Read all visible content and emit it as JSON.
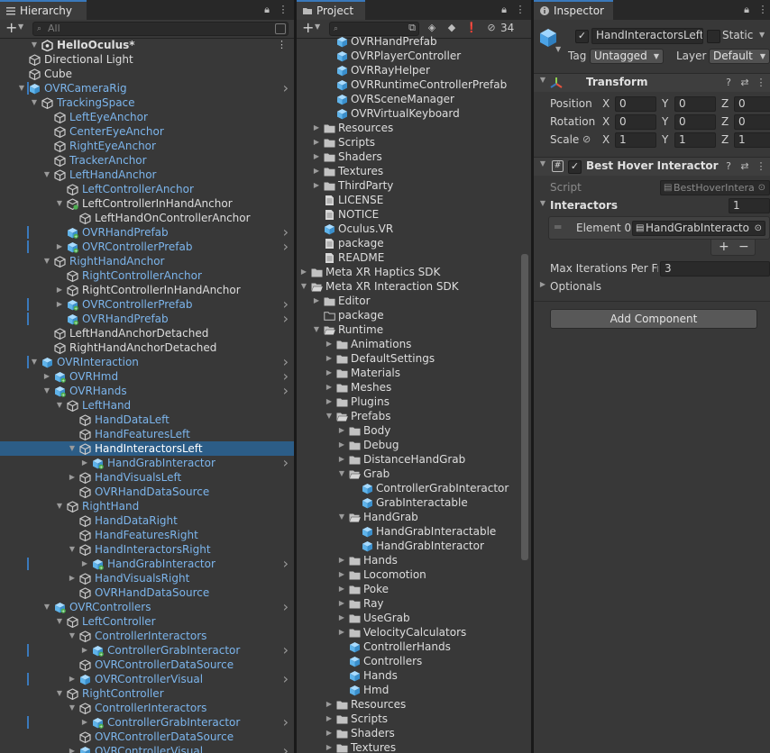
{
  "hierarchy": {
    "tab_label": "Hierarchy",
    "add_label": "+",
    "search_placeholder": "All",
    "scene_name": "HelloOculus*",
    "rows": [
      {
        "label": "Directional Light",
        "depth": 1,
        "color": "white",
        "arrow": "",
        "icon": "cube-outline"
      },
      {
        "label": "Cube",
        "depth": 1,
        "color": "white",
        "arrow": "",
        "icon": "cube-outline"
      },
      {
        "label": "OVRCameraRig",
        "depth": 1,
        "color": "blue",
        "arrow": "open",
        "icon": "prefab",
        "chev": true,
        "bar": true
      },
      {
        "label": "TrackingSpace",
        "depth": 2,
        "color": "blue",
        "arrow": "open",
        "icon": "cube-outline"
      },
      {
        "label": "LeftEyeAnchor",
        "depth": 3,
        "color": "blue",
        "arrow": "",
        "icon": "cube-outline"
      },
      {
        "label": "CenterEyeAnchor",
        "depth": 3,
        "color": "blue",
        "arrow": "",
        "icon": "cube-outline"
      },
      {
        "label": "RightEyeAnchor",
        "depth": 3,
        "color": "blue",
        "arrow": "",
        "icon": "cube-outline"
      },
      {
        "label": "TrackerAnchor",
        "depth": 3,
        "color": "blue",
        "arrow": "",
        "icon": "cube-outline"
      },
      {
        "label": "LeftHandAnchor",
        "depth": 3,
        "color": "blue",
        "arrow": "open",
        "icon": "cube-outline"
      },
      {
        "label": "LeftControllerAnchor",
        "depth": 4,
        "color": "blue",
        "arrow": "",
        "icon": "cube-outline"
      },
      {
        "label": "LeftControllerInHandAnchor",
        "depth": 4,
        "color": "white",
        "arrow": "open",
        "icon": "cube-green"
      },
      {
        "label": "LeftHandOnControllerAnchor",
        "depth": 5,
        "color": "white",
        "arrow": "",
        "icon": "cube-outline"
      },
      {
        "label": "OVRHandPrefab",
        "depth": 4,
        "color": "blue",
        "arrow": "",
        "icon": "prefab-green",
        "chev": true,
        "bar": true
      },
      {
        "label": "OVRControllerPrefab",
        "depth": 4,
        "color": "blue",
        "arrow": "closed",
        "icon": "prefab-green",
        "chev": true,
        "bar": true
      },
      {
        "label": "RightHandAnchor",
        "depth": 3,
        "color": "blue",
        "arrow": "open",
        "icon": "cube-outline"
      },
      {
        "label": "RightControllerAnchor",
        "depth": 4,
        "color": "blue",
        "arrow": "",
        "icon": "cube-outline"
      },
      {
        "label": "RightControllerInHandAnchor",
        "depth": 4,
        "color": "white",
        "arrow": "closed",
        "icon": "cube-outline"
      },
      {
        "label": "OVRControllerPrefab",
        "depth": 4,
        "color": "blue",
        "arrow": "closed",
        "icon": "prefab-green",
        "chev": true,
        "bar": true
      },
      {
        "label": "OVRHandPrefab",
        "depth": 4,
        "color": "blue",
        "arrow": "",
        "icon": "prefab-green",
        "chev": true,
        "bar": true
      },
      {
        "label": "LeftHandAnchorDetached",
        "depth": 3,
        "color": "white",
        "arrow": "",
        "icon": "cube-outline"
      },
      {
        "label": "RightHandAnchorDetached",
        "depth": 3,
        "color": "white",
        "arrow": "",
        "icon": "cube-outline"
      },
      {
        "label": "OVRInteraction",
        "depth": 2,
        "color": "blue",
        "arrow": "open",
        "icon": "prefab",
        "chev": true,
        "bar": true
      },
      {
        "label": "OVRHmd",
        "depth": 3,
        "color": "blue",
        "arrow": "closed",
        "icon": "prefab-green",
        "chev": true
      },
      {
        "label": "OVRHands",
        "depth": 3,
        "color": "blue",
        "arrow": "open",
        "icon": "prefab-green",
        "chev": true
      },
      {
        "label": "LeftHand",
        "depth": 4,
        "color": "blue",
        "arrow": "open",
        "icon": "cube-outline"
      },
      {
        "label": "HandDataLeft",
        "depth": 5,
        "color": "blue",
        "arrow": "",
        "icon": "cube-outline"
      },
      {
        "label": "HandFeaturesLeft",
        "depth": 5,
        "color": "blue",
        "arrow": "",
        "icon": "cube-outline"
      },
      {
        "label": "HandInteractorsLeft",
        "depth": 5,
        "color": "white",
        "arrow": "open",
        "icon": "cube-outline",
        "selected": true
      },
      {
        "label": "HandGrabInteractor",
        "depth": 6,
        "color": "blue",
        "arrow": "closed",
        "icon": "prefab-green",
        "chev": true
      },
      {
        "label": "HandVisualsLeft",
        "depth": 5,
        "color": "blue",
        "arrow": "closed",
        "icon": "cube-outline"
      },
      {
        "label": "OVRHandDataSource",
        "depth": 5,
        "color": "blue",
        "arrow": "",
        "icon": "cube-outline"
      },
      {
        "label": "RightHand",
        "depth": 4,
        "color": "blue",
        "arrow": "open",
        "icon": "cube-outline"
      },
      {
        "label": "HandDataRight",
        "depth": 5,
        "color": "blue",
        "arrow": "",
        "icon": "cube-outline"
      },
      {
        "label": "HandFeaturesRight",
        "depth": 5,
        "color": "blue",
        "arrow": "",
        "icon": "cube-outline"
      },
      {
        "label": "HandInteractorsRight",
        "depth": 5,
        "color": "blue",
        "arrow": "open",
        "icon": "cube-outline"
      },
      {
        "label": "HandGrabInteractor",
        "depth": 6,
        "color": "blue",
        "arrow": "closed",
        "icon": "prefab-green",
        "chev": true,
        "bar": true
      },
      {
        "label": "HandVisualsRight",
        "depth": 5,
        "color": "blue",
        "arrow": "closed",
        "icon": "cube-outline"
      },
      {
        "label": "OVRHandDataSource",
        "depth": 5,
        "color": "blue",
        "arrow": "",
        "icon": "cube-outline"
      },
      {
        "label": "OVRControllers",
        "depth": 3,
        "color": "blue",
        "arrow": "open",
        "icon": "prefab-green",
        "chev": true
      },
      {
        "label": "LeftController",
        "depth": 4,
        "color": "blue",
        "arrow": "open",
        "icon": "cube-outline"
      },
      {
        "label": "ControllerInteractors",
        "depth": 5,
        "color": "blue",
        "arrow": "open",
        "icon": "cube-outline"
      },
      {
        "label": "ControllerGrabInteractor",
        "depth": 6,
        "color": "blue",
        "arrow": "closed",
        "icon": "prefab-green",
        "chev": true,
        "bar": true
      },
      {
        "label": "OVRControllerDataSource",
        "depth": 5,
        "color": "blue",
        "arrow": "",
        "icon": "cube-outline"
      },
      {
        "label": "OVRControllerVisual",
        "depth": 5,
        "color": "blue",
        "arrow": "closed",
        "icon": "prefab",
        "chev": true,
        "bar": true
      },
      {
        "label": "RightController",
        "depth": 4,
        "color": "blue",
        "arrow": "open",
        "icon": "cube-outline"
      },
      {
        "label": "ControllerInteractors",
        "depth": 5,
        "color": "blue",
        "arrow": "open",
        "icon": "cube-outline"
      },
      {
        "label": "ControllerGrabInteractor",
        "depth": 6,
        "color": "blue",
        "arrow": "closed",
        "icon": "prefab-green",
        "chev": true,
        "bar": true
      },
      {
        "label": "OVRControllerDataSource",
        "depth": 5,
        "color": "blue",
        "arrow": "",
        "icon": "cube-outline"
      },
      {
        "label": "OVRControllerVisual",
        "depth": 5,
        "color": "blue",
        "arrow": "closed",
        "icon": "prefab",
        "chev": true
      }
    ]
  },
  "project": {
    "tab_label": "Project",
    "add_label": "+",
    "hidden_count": "34",
    "rows": [
      {
        "label": "OVRHandPrefab",
        "depth": 4,
        "arrow": "",
        "icon": "prefab"
      },
      {
        "label": "OVRPlayerController",
        "depth": 4,
        "arrow": "",
        "icon": "prefab"
      },
      {
        "label": "OVRRayHelper",
        "depth": 4,
        "arrow": "",
        "icon": "prefab"
      },
      {
        "label": "OVRRuntimeControllerPrefab",
        "depth": 4,
        "arrow": "",
        "icon": "prefab"
      },
      {
        "label": "OVRSceneManager",
        "depth": 4,
        "arrow": "",
        "icon": "prefab"
      },
      {
        "label": "OVRVirtualKeyboard",
        "depth": 4,
        "arrow": "",
        "icon": "prefab"
      },
      {
        "label": "Resources",
        "depth": 3,
        "arrow": "closed",
        "icon": "folder"
      },
      {
        "label": "Scripts",
        "depth": 3,
        "arrow": "closed",
        "icon": "folder"
      },
      {
        "label": "Shaders",
        "depth": 3,
        "arrow": "closed",
        "icon": "folder"
      },
      {
        "label": "Textures",
        "depth": 3,
        "arrow": "closed",
        "icon": "folder"
      },
      {
        "label": "ThirdParty",
        "depth": 3,
        "arrow": "closed",
        "icon": "folder"
      },
      {
        "label": "LICENSE",
        "depth": 3,
        "arrow": "",
        "icon": "doc"
      },
      {
        "label": "NOTICE",
        "depth": 3,
        "arrow": "",
        "icon": "doc"
      },
      {
        "label": "Oculus.VR",
        "depth": 3,
        "arrow": "",
        "icon": "asm"
      },
      {
        "label": "package",
        "depth": 3,
        "arrow": "",
        "icon": "doc"
      },
      {
        "label": "README",
        "depth": 3,
        "arrow": "",
        "icon": "doc"
      },
      {
        "label": "Meta XR Haptics SDK",
        "depth": 2,
        "arrow": "closed",
        "icon": "folder"
      },
      {
        "label": "Meta XR Interaction SDK",
        "depth": 2,
        "arrow": "open",
        "icon": "folder-open"
      },
      {
        "label": "Editor",
        "depth": 3,
        "arrow": "closed",
        "icon": "folder"
      },
      {
        "label": "package",
        "depth": 3,
        "arrow": "",
        "icon": "folder-empty"
      },
      {
        "label": "Runtime",
        "depth": 3,
        "arrow": "open",
        "icon": "folder-open"
      },
      {
        "label": "Animations",
        "depth": 4,
        "arrow": "closed",
        "icon": "folder"
      },
      {
        "label": "DefaultSettings",
        "depth": 4,
        "arrow": "closed",
        "icon": "folder"
      },
      {
        "label": "Materials",
        "depth": 4,
        "arrow": "closed",
        "icon": "folder"
      },
      {
        "label": "Meshes",
        "depth": 4,
        "arrow": "closed",
        "icon": "folder"
      },
      {
        "label": "Plugins",
        "depth": 4,
        "arrow": "closed",
        "icon": "folder"
      },
      {
        "label": "Prefabs",
        "depth": 4,
        "arrow": "open",
        "icon": "folder-open"
      },
      {
        "label": "Body",
        "depth": 5,
        "arrow": "closed",
        "icon": "folder"
      },
      {
        "label": "Debug",
        "depth": 5,
        "arrow": "closed",
        "icon": "folder"
      },
      {
        "label": "DistanceHandGrab",
        "depth": 5,
        "arrow": "closed",
        "icon": "folder"
      },
      {
        "label": "Grab",
        "depth": 5,
        "arrow": "open",
        "icon": "folder-open"
      },
      {
        "label": "ControllerGrabInteractor",
        "depth": 6,
        "arrow": "",
        "icon": "prefab"
      },
      {
        "label": "GrabInteractable",
        "depth": 6,
        "arrow": "",
        "icon": "prefab"
      },
      {
        "label": "HandGrab",
        "depth": 5,
        "arrow": "open",
        "icon": "folder-open"
      },
      {
        "label": "HandGrabInteractable",
        "depth": 6,
        "arrow": "",
        "icon": "prefab"
      },
      {
        "label": "HandGrabInteractor",
        "depth": 6,
        "arrow": "",
        "icon": "prefab"
      },
      {
        "label": "Hands",
        "depth": 5,
        "arrow": "closed",
        "icon": "folder"
      },
      {
        "label": "Locomotion",
        "depth": 5,
        "arrow": "closed",
        "icon": "folder"
      },
      {
        "label": "Poke",
        "depth": 5,
        "arrow": "closed",
        "icon": "folder"
      },
      {
        "label": "Ray",
        "depth": 5,
        "arrow": "closed",
        "icon": "folder"
      },
      {
        "label": "UseGrab",
        "depth": 5,
        "arrow": "closed",
        "icon": "folder"
      },
      {
        "label": "VelocityCalculators",
        "depth": 5,
        "arrow": "closed",
        "icon": "folder"
      },
      {
        "label": "ControllerHands",
        "depth": 5,
        "arrow": "",
        "icon": "prefab"
      },
      {
        "label": "Controllers",
        "depth": 5,
        "arrow": "",
        "icon": "prefab"
      },
      {
        "label": "Hands",
        "depth": 5,
        "arrow": "",
        "icon": "prefab"
      },
      {
        "label": "Hmd",
        "depth": 5,
        "arrow": "",
        "icon": "prefab"
      },
      {
        "label": "Resources",
        "depth": 4,
        "arrow": "closed",
        "icon": "folder"
      },
      {
        "label": "Scripts",
        "depth": 4,
        "arrow": "closed",
        "icon": "folder"
      },
      {
        "label": "Shaders",
        "depth": 4,
        "arrow": "closed",
        "icon": "folder"
      },
      {
        "label": "Textures",
        "depth": 4,
        "arrow": "closed",
        "icon": "folder"
      }
    ]
  },
  "inspector": {
    "tab_label": "Inspector",
    "object_name": "HandInteractorsLeft",
    "static_label": "Static",
    "tag_label": "Tag",
    "tag_value": "Untagged",
    "layer_label": "Layer",
    "layer_value": "Default",
    "transform": {
      "title": "Transform",
      "position_label": "Position",
      "rotation_label": "Rotation",
      "scale_label": "Scale",
      "x_label": "X",
      "y_label": "Y",
      "z_label": "Z",
      "position": [
        "0",
        "0",
        "0"
      ],
      "rotation": [
        "0",
        "0",
        "0"
      ],
      "scale": [
        "1",
        "1",
        "1"
      ]
    },
    "component": {
      "title": "Best Hover Interactor Gr",
      "script_label": "Script",
      "script_value": "BestHoverIntera",
      "interactors_label": "Interactors",
      "interactors_count": "1",
      "element_label": "Element 0",
      "element_value": "HandGrabInteracto",
      "plus_label": "+",
      "minus_label": "−",
      "max_iter_label": "Max Iterations Per Fra",
      "max_iter_value": "3",
      "optionals_label": "Optionals"
    },
    "add_component_label": "Add Component"
  },
  "colors": {
    "selection": "#2c5d87",
    "prefab_blue": "#7cb5ec",
    "cube_icon": "#5fb3ea",
    "accent_tab": "#3a79bb"
  }
}
